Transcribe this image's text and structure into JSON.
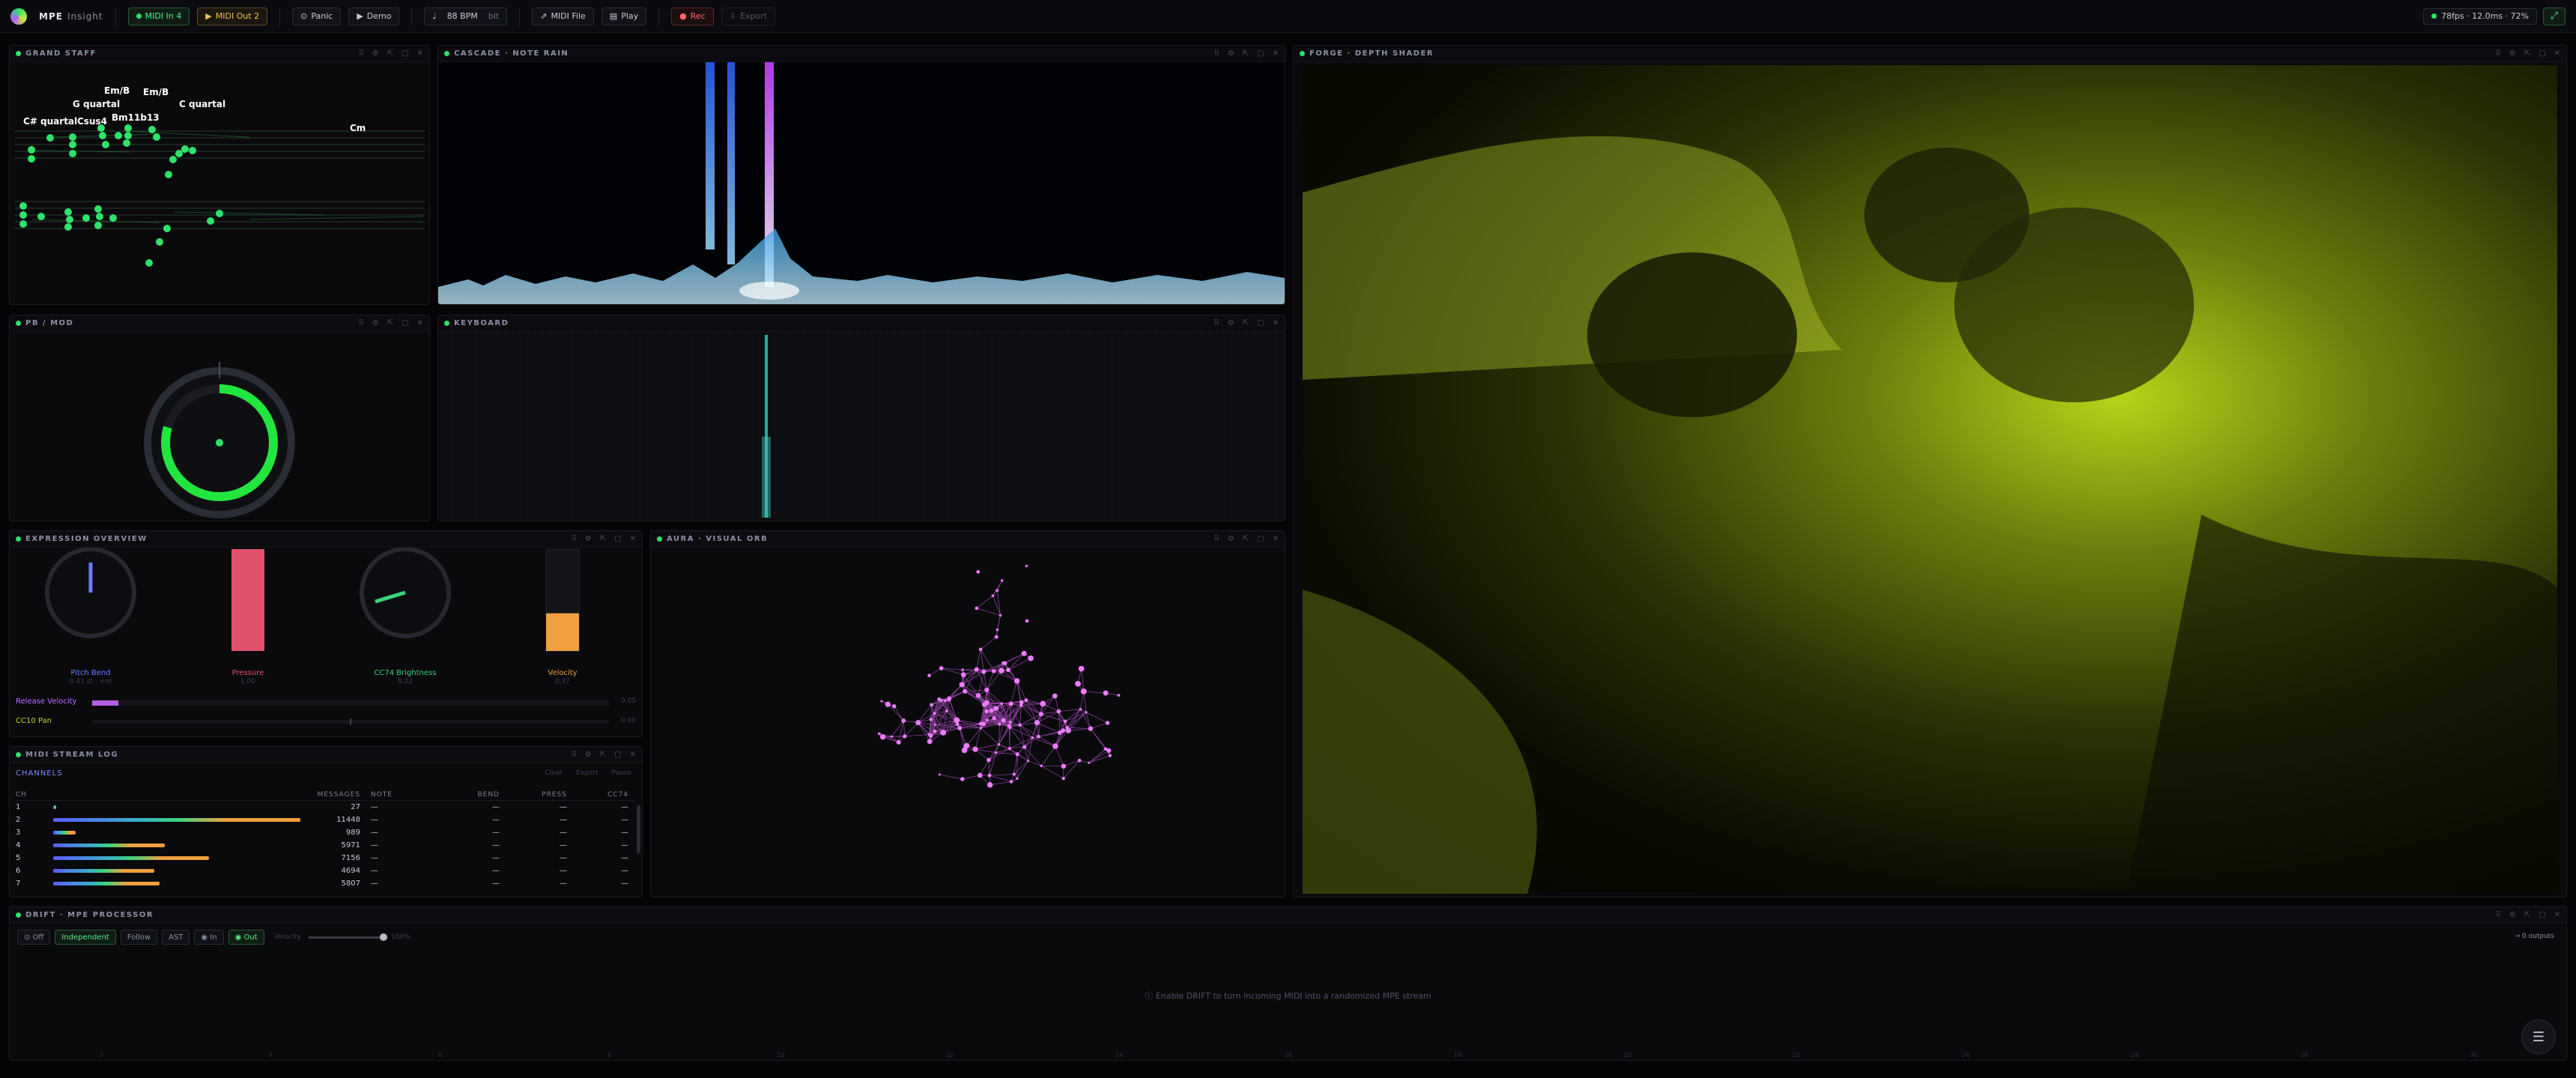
{
  "app": {
    "brand": "MPE",
    "brand_sub": "Insight"
  },
  "toolbar": {
    "midi_in": "MIDI In 4",
    "midi_out": "MIDI Out 2",
    "panic": "Panic",
    "demo": "Demo",
    "tempo": "88 BPM",
    "tempo_unit": "bit",
    "midi_file": "MIDI File",
    "play": "Play",
    "rec": "Rec",
    "export": "Export",
    "perf": "78fps · 12.0ms · 72%"
  },
  "colors": {
    "accent": "#2ee36b",
    "pressure": "#e0506a",
    "velocity": "#f0a040",
    "brightness": "#3bd27a",
    "pitch": "#6b7cff",
    "orb": "#e070ff",
    "forge": "#d4f020"
  },
  "panels": {
    "grand_staff": {
      "title": "GRAND STAFF",
      "chords": [
        "C# quartal",
        "G quartal",
        "Csus4",
        "Em/B",
        "Bm11b13",
        "Em/B",
        "C quartal",
        "Cm"
      ]
    },
    "cascade": {
      "title": "CASCADE · NOTE RAIN"
    },
    "forge": {
      "title": "FORGE · DEPTH SHADER"
    },
    "pbmod": {
      "title": "PB / MOD"
    },
    "keyboard": {
      "title": "KEYBOARD"
    },
    "expression": {
      "title": "EXPRESSION OVERVIEW",
      "gauges": [
        {
          "label": "Pitch Bend",
          "value": "0.41 st · +nt",
          "color": "#6b7cff"
        },
        {
          "label": "Pressure",
          "value": "1.00",
          "color": "#e0506a",
          "level": 1.0
        },
        {
          "label": "CC74 Brightness",
          "value": "0.22",
          "color": "#3bd27a"
        },
        {
          "label": "Velocity",
          "value": "0.37",
          "color": "#f0a040",
          "level": 0.37
        }
      ],
      "release_velocity": {
        "label": "Release Velocity",
        "value": "0.05",
        "level": 0.05
      },
      "cc10": {
        "label": "CC10 Pan",
        "value": "0.00",
        "level": 0.0
      }
    },
    "aura": {
      "title": "AURA · VISUAL ORB"
    },
    "stream": {
      "title": "MIDI STREAM LOG",
      "tab": "CHANNELS",
      "actions": [
        "Clear",
        "Export",
        "Pause"
      ],
      "columns": [
        "CH",
        "MESSAGES",
        "NOTE",
        "BEND",
        "PRESS",
        "CC74"
      ],
      "rows": [
        {
          "ch": "1",
          "msgs": "27",
          "note": "—",
          "bend": "—",
          "press": "—",
          "cc": "—",
          "level": 0.01
        },
        {
          "ch": "2",
          "msgs": "11448",
          "note": "—",
          "bend": "—",
          "press": "—",
          "cc": "—",
          "level": 1.0
        },
        {
          "ch": "3",
          "msgs": "989",
          "note": "—",
          "bend": "—",
          "press": "—",
          "cc": "—",
          "level": 0.09
        },
        {
          "ch": "4",
          "msgs": "5971",
          "note": "—",
          "bend": "—",
          "press": "—",
          "cc": "—",
          "level": 0.45
        },
        {
          "ch": "5",
          "msgs": "7156",
          "note": "—",
          "bend": "—",
          "press": "—",
          "cc": "—",
          "level": 0.63
        },
        {
          "ch": "6",
          "msgs": "4694",
          "note": "—",
          "bend": "—",
          "press": "—",
          "cc": "—",
          "level": 0.41
        },
        {
          "ch": "7",
          "msgs": "5807",
          "note": "—",
          "bend": "—",
          "press": "—",
          "cc": "—",
          "level": 0.43
        }
      ]
    },
    "drift": {
      "title": "DRIFT · MPE PROCESSOR",
      "modes": [
        "Off",
        "Independent",
        "Follow",
        "AST",
        "In",
        "Out"
      ],
      "velocity_label": "Velocity",
      "velocity_value": "100%",
      "outputs": "0 outputs",
      "hint": "Enable DRIFT to turn incoming MIDI into a randomized MPE stream",
      "axis": [
        "2",
        "4",
        "6",
        "8",
        "10",
        "12",
        "14",
        "16",
        "18",
        "20",
        "22",
        "24",
        "26",
        "28",
        "30"
      ]
    }
  }
}
